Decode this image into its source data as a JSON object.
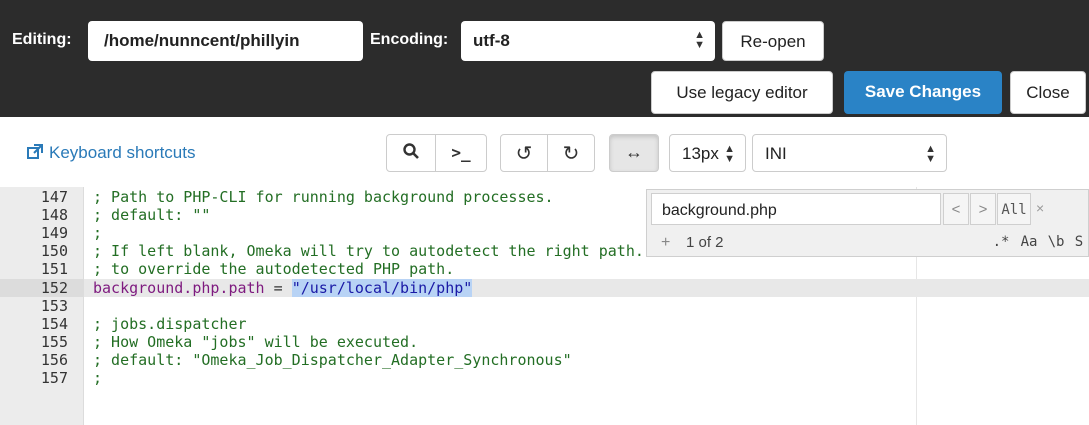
{
  "header": {
    "editing_label": "Editing:",
    "file_path": "/home/nunncent/phillyin",
    "encoding_label": "Encoding:",
    "encoding_value": "utf-8",
    "reopen_label": "Re-open",
    "legacy_label": "Use legacy editor",
    "save_label": "Save Changes",
    "close_label": "Close",
    "save_color": "#2a83c6"
  },
  "toolbar": {
    "shortcuts_label": "Keyboard shortcuts",
    "font_size": "13px",
    "mode": "INI",
    "icons": [
      "search-icon",
      "terminal-icon",
      "undo-icon",
      "redo-icon",
      "wrap-icon"
    ]
  },
  "editor": {
    "lines": [
      {
        "n": "147",
        "text": "; Path to PHP-CLI for running background processes."
      },
      {
        "n": "148",
        "text": "; default: \"\""
      },
      {
        "n": "149",
        "text": ";"
      },
      {
        "n": "150",
        "text": "; If left blank, Omeka will try to autodetect the right path. Set this"
      },
      {
        "n": "151",
        "text": "; to override the autodetected PHP path."
      },
      {
        "n": "152",
        "key": "background.php.path",
        "op": " = ",
        "value": "\"/usr/local/bin/php\""
      },
      {
        "n": "153",
        "text": ""
      },
      {
        "n": "154",
        "text": "; jobs.dispatcher"
      },
      {
        "n": "155",
        "text": "; How Omeka \"jobs\" will be executed."
      },
      {
        "n": "156",
        "text": "; default: \"Omeka_Job_Dispatcher_Adapter_Synchronous\""
      },
      {
        "n": "157",
        "text": ";"
      }
    ]
  },
  "find": {
    "query": "background.php",
    "prev": "<",
    "next": ">",
    "all": "All",
    "close": "×",
    "plus": "+",
    "count": "1 of 2",
    "regex": ".*",
    "case": "Aa",
    "word": "\\b",
    "selection": "S"
  }
}
